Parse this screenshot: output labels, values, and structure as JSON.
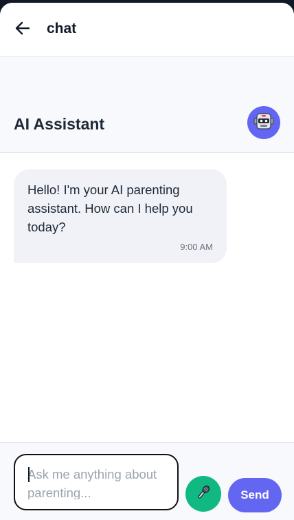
{
  "topbar": {
    "back_icon": "arrow-left-icon",
    "title": "chat"
  },
  "assistant": {
    "name": "AI Assistant",
    "avatar_icon": "robot-icon",
    "avatar_color": "#6366f1"
  },
  "messages": [
    {
      "sender": "assistant",
      "text": "Hello! I'm your AI parenting assistant. How can I help you today?",
      "time": "9:00 AM"
    }
  ],
  "composer": {
    "placeholder": "Ask me anything about parenting...",
    "value": "",
    "mic_icon": "microphone-icon",
    "mic_color": "#10b981",
    "send_label": "Send",
    "send_color": "#6366f1"
  }
}
